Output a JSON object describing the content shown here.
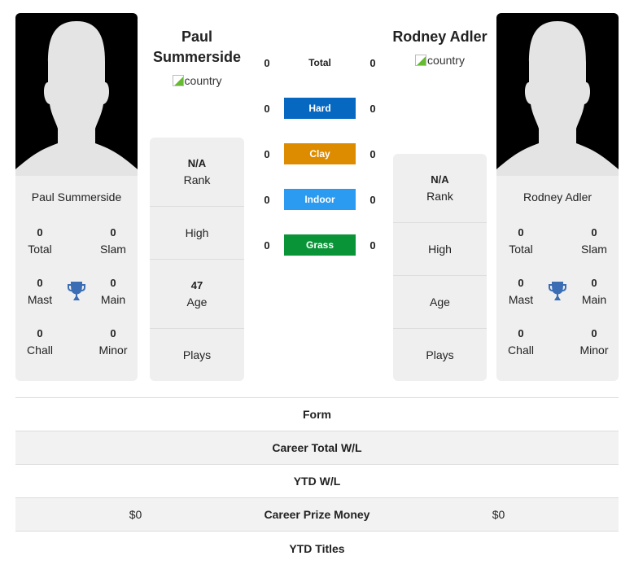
{
  "player1": {
    "name": "Paul Summerside",
    "country_alt": "country",
    "titles": [
      {
        "value": "0",
        "label": "Total"
      },
      {
        "value": "0",
        "label": "Slam"
      },
      {
        "value": "0",
        "label": "Mast"
      },
      {
        "value": "0",
        "label": "Main"
      },
      {
        "value": "0",
        "label": "Chall"
      },
      {
        "value": "0",
        "label": "Minor"
      }
    ],
    "info": {
      "rank_value": "N/A",
      "rank_label": "Rank",
      "high_label": "High",
      "age_value": "47",
      "age_label": "Age",
      "plays_label": "Plays"
    }
  },
  "player2": {
    "name": "Rodney Adler",
    "country_alt": "country",
    "titles": [
      {
        "value": "0",
        "label": "Total"
      },
      {
        "value": "0",
        "label": "Slam"
      },
      {
        "value": "0",
        "label": "Mast"
      },
      {
        "value": "0",
        "label": "Main"
      },
      {
        "value": "0",
        "label": "Chall"
      },
      {
        "value": "0",
        "label": "Minor"
      }
    ],
    "info": {
      "rank_value": "N/A",
      "rank_label": "Rank",
      "high_label": "High",
      "age_label": "Age",
      "plays_label": "Plays"
    }
  },
  "h2h": {
    "rows": [
      {
        "label": "Total",
        "p1": "0",
        "p2": "0",
        "color": ""
      },
      {
        "label": "Hard",
        "p1": "0",
        "p2": "0",
        "color": "#0768c2"
      },
      {
        "label": "Clay",
        "p1": "0",
        "p2": "0",
        "color": "#dd8c00"
      },
      {
        "label": "Indoor",
        "p1": "0",
        "p2": "0",
        "color": "#2a9bf1"
      },
      {
        "label": "Grass",
        "p1": "0",
        "p2": "0",
        "color": "#0a9438"
      }
    ]
  },
  "stats": [
    {
      "label": "Form",
      "p1": "",
      "p2": ""
    },
    {
      "label": "Career Total W/L",
      "p1": "",
      "p2": ""
    },
    {
      "label": "YTD W/L",
      "p1": "",
      "p2": ""
    },
    {
      "label": "Career Prize Money",
      "p1": "$0",
      "p2": "$0"
    },
    {
      "label": "YTD Titles",
      "p1": "",
      "p2": ""
    }
  ],
  "colors": {
    "trophy": "#3b6db5",
    "card_bg": "#efefef"
  }
}
